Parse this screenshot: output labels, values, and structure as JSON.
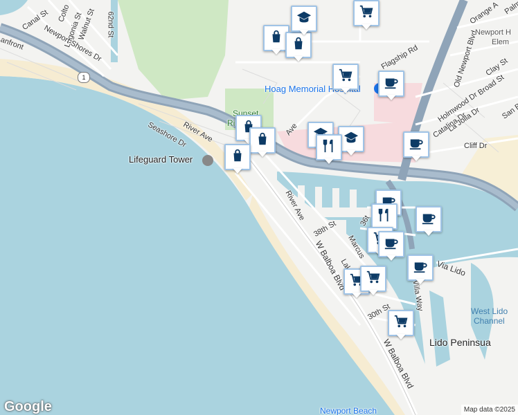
{
  "map": {
    "streets": {
      "canal_st": "Canal St",
      "colton": "Colto",
      "walnut_st": "Walnut St",
      "lugonia_st": "Lugonia St",
      "st_62nd": "62nd St",
      "oceanfront": "anfront",
      "newport_shores_dr": "Newport Shores Dr",
      "seashore_dr": "Seashore Dr",
      "river_ave_1": "River Ave",
      "river_ave_2": "River Ave",
      "w_balboa_1": "W Balboa Blvd",
      "w_balboa_2": "W Balboa Blvd",
      "st_38th": "38th St",
      "st_36th": "36t",
      "st_30th": "30th St",
      "marcus": "Marcus",
      "lake": "Lak",
      "villa_way": "Villa Way",
      "via_lido": "Via Lido",
      "flagship_rd": "Flagship Rd",
      "old_newport_blvd": "Old Newport Blvd",
      "orange_ave": "Orange A",
      "palm": "Palm",
      "clay_st": "Clay St",
      "broad_st": "Broad St",
      "holmwood_dr": "Holmwood Dr",
      "catalina_dr": "Catalina Dr",
      "la_jolla_dr": "La Jolla Dr",
      "cliff_dr": "Cliff Dr",
      "san_b": "San B",
      "ave_frag": "Ave"
    },
    "places": {
      "hoag": "Hoag Memorial Hospital",
      "lifeguard": "Lifeguard Tower",
      "sunset": "Sunset",
      "sunset_ri": "Ri",
      "newport_harbor": "Newport H",
      "elem": "Elem",
      "lido_peninsula": "Lido Peninsua",
      "west_lido_1": "West Lido",
      "west_lido_2": "Channel",
      "newport_beach": "Newport Beach"
    },
    "highway_shield": "1",
    "logo": "Google",
    "attribution": "Map data ©2025"
  },
  "markers": [
    {
      "icon": "shopping-bag-icon"
    },
    {
      "icon": "shopping-bag-icon"
    },
    {
      "icon": "school-icon"
    },
    {
      "icon": "shopping-cart-icon"
    },
    {
      "icon": "shopping-cart-icon"
    },
    {
      "icon": "coffee-icon"
    },
    {
      "icon": "shopping-bag-icon"
    },
    {
      "icon": "shopping-bag-icon"
    },
    {
      "icon": "school-icon"
    },
    {
      "icon": "school-icon"
    },
    {
      "icon": "restaurant-icon"
    },
    {
      "icon": "coffee-icon"
    },
    {
      "icon": "shopping-bag-icon"
    },
    {
      "icon": "coffee-icon"
    },
    {
      "icon": "restaurant-icon"
    },
    {
      "icon": "coffee-icon"
    },
    {
      "icon": "shopping-cart-icon"
    },
    {
      "icon": "coffee-icon"
    },
    {
      "icon": "coffee-icon"
    },
    {
      "icon": "shopping-cart-icon"
    },
    {
      "icon": "shopping-cart-icon"
    },
    {
      "icon": "shopping-cart-icon"
    }
  ],
  "colors": {
    "water": "#aad3df",
    "marker_icon": "#0d3b66",
    "land": "#f3f3f1",
    "highway": "#8fa4b8"
  }
}
